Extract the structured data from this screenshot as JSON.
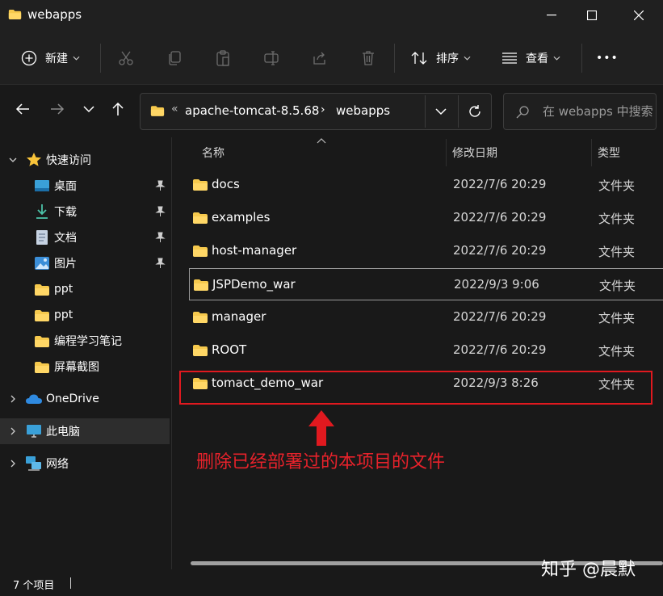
{
  "window": {
    "title": "webapps"
  },
  "toolbar": {
    "new_label": "新建",
    "sort_label": "排序",
    "view_label": "查看",
    "more_label": "•••"
  },
  "address": {
    "overflow": "«",
    "segment1": "apache-tomcat-8.5.68",
    "separator": "›",
    "segment2": "webapps"
  },
  "search": {
    "placeholder": "在 webapps 中搜索"
  },
  "sidebar": {
    "quick_access": "快速访问",
    "items": [
      {
        "label": "桌面",
        "icon": "desktop-icon",
        "pinned": true
      },
      {
        "label": "下载",
        "icon": "download-icon",
        "pinned": true
      },
      {
        "label": "文档",
        "icon": "document-icon",
        "pinned": true
      },
      {
        "label": "图片",
        "icon": "picture-icon",
        "pinned": true
      },
      {
        "label": "ppt",
        "icon": "folder-icon",
        "pinned": false
      },
      {
        "label": "ppt",
        "icon": "folder-icon",
        "pinned": false
      },
      {
        "label": "编程学习笔记",
        "icon": "folder-icon",
        "pinned": false
      },
      {
        "label": "屏幕截图",
        "icon": "folder-icon",
        "pinned": false
      }
    ],
    "onedrive": "OneDrive",
    "this_pc": "此电脑",
    "network": "网络"
  },
  "columns": {
    "name": "名称",
    "date": "修改日期",
    "type": "类型"
  },
  "files": [
    {
      "name": "docs",
      "date": "2022/7/6 20:29",
      "type": "文件夹"
    },
    {
      "name": "examples",
      "date": "2022/7/6 20:29",
      "type": "文件夹"
    },
    {
      "name": "host-manager",
      "date": "2022/7/6 20:29",
      "type": "文件夹"
    },
    {
      "name": "JSPDemo_war",
      "date": "2022/9/3 9:06",
      "type": "文件夹"
    },
    {
      "name": "manager",
      "date": "2022/7/6 20:29",
      "type": "文件夹"
    },
    {
      "name": "ROOT",
      "date": "2022/7/6 20:29",
      "type": "文件夹"
    },
    {
      "name": "tomact_demo_war",
      "date": "2022/9/3 8:26",
      "type": "文件夹"
    }
  ],
  "annotation": {
    "text": "删除已经部署过的本项目的文件",
    "color": "#e8222b"
  },
  "status": {
    "count": "7 个项目"
  },
  "watermark": {
    "text": "知乎 @晨默"
  },
  "colors": {
    "folder": "#f6c94d",
    "accent": "#e0191f",
    "background": "#191919"
  }
}
